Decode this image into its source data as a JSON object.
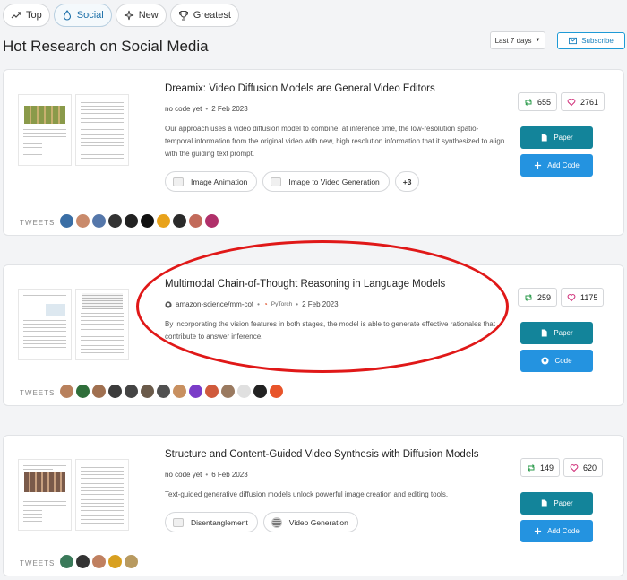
{
  "tabs": [
    {
      "label": "Top",
      "icon": "trending-icon",
      "active": false
    },
    {
      "label": "Social",
      "icon": "drop-icon",
      "active": true
    },
    {
      "label": "New",
      "icon": "sparkle-icon",
      "active": false
    },
    {
      "label": "Greatest",
      "icon": "trophy-icon",
      "active": false
    }
  ],
  "page_title": "Hot Research on Social Media",
  "period": {
    "selected": "Last 7 days"
  },
  "subscribe_label": "Subscribe",
  "tweets_label": "TWEETS",
  "papers": [
    {
      "title": "Dreamix: Video Diffusion Models are General Video Editors",
      "code_status": "no code yet",
      "date": "2 Feb 2023",
      "description": "Our approach uses a video diffusion model to combine, at inference time, the low-resolution spatio-temporal information from the original video with new, high resolution information that it synthesized to align with the guiding text prompt.",
      "tags": [
        "Image Animation",
        "Image to Video Generation"
      ],
      "more_tags": "+3",
      "retweets": "655",
      "likes": "2761",
      "paper_button": "Paper",
      "code_button": "Add Code",
      "avatar_colors": [
        "#3a6ea5",
        "#c98a6b",
        "#5577aa",
        "#333333",
        "#222222",
        "#111111",
        "#e8a21a",
        "#2a2a2a",
        "#c26a5a",
        "#b0306a"
      ]
    },
    {
      "title": "Multimodal Chain-of-Thought Reasoning in Language Models",
      "repo": "amazon-science/mm-cot",
      "framework": "PyTorch",
      "date": "2 Feb 2023",
      "description": "By incorporating the vision features in both stages, the model is able to generate effective rationales that contribute to answer inference.",
      "retweets": "259",
      "likes": "1175",
      "paper_button": "Paper",
      "code_button": "Code",
      "avatar_colors": [
        "#b8805c",
        "#2f6e3a",
        "#a07050",
        "#3c3c3c",
        "#444444",
        "#6a5a4a",
        "#505050",
        "#c89060",
        "#7a3cc8",
        "#d05a3c",
        "#9a7a60",
        "#e0e0e0",
        "#222222",
        "#e8542a"
      ]
    },
    {
      "title": "Structure and Content-Guided Video Synthesis with Diffusion Models",
      "code_status": "no code yet",
      "date": "6 Feb 2023",
      "description": "Text-guided generative diffusion models unlock powerful image creation and editing tools.",
      "tags": [
        "Disentanglement",
        "Video Generation"
      ],
      "retweets": "149",
      "likes": "620",
      "paper_button": "Paper",
      "code_button": "Add Code",
      "avatar_colors": [
        "#3a7a5a",
        "#333333",
        "#c08060",
        "#d8a020",
        "#b89a60"
      ]
    }
  ]
}
